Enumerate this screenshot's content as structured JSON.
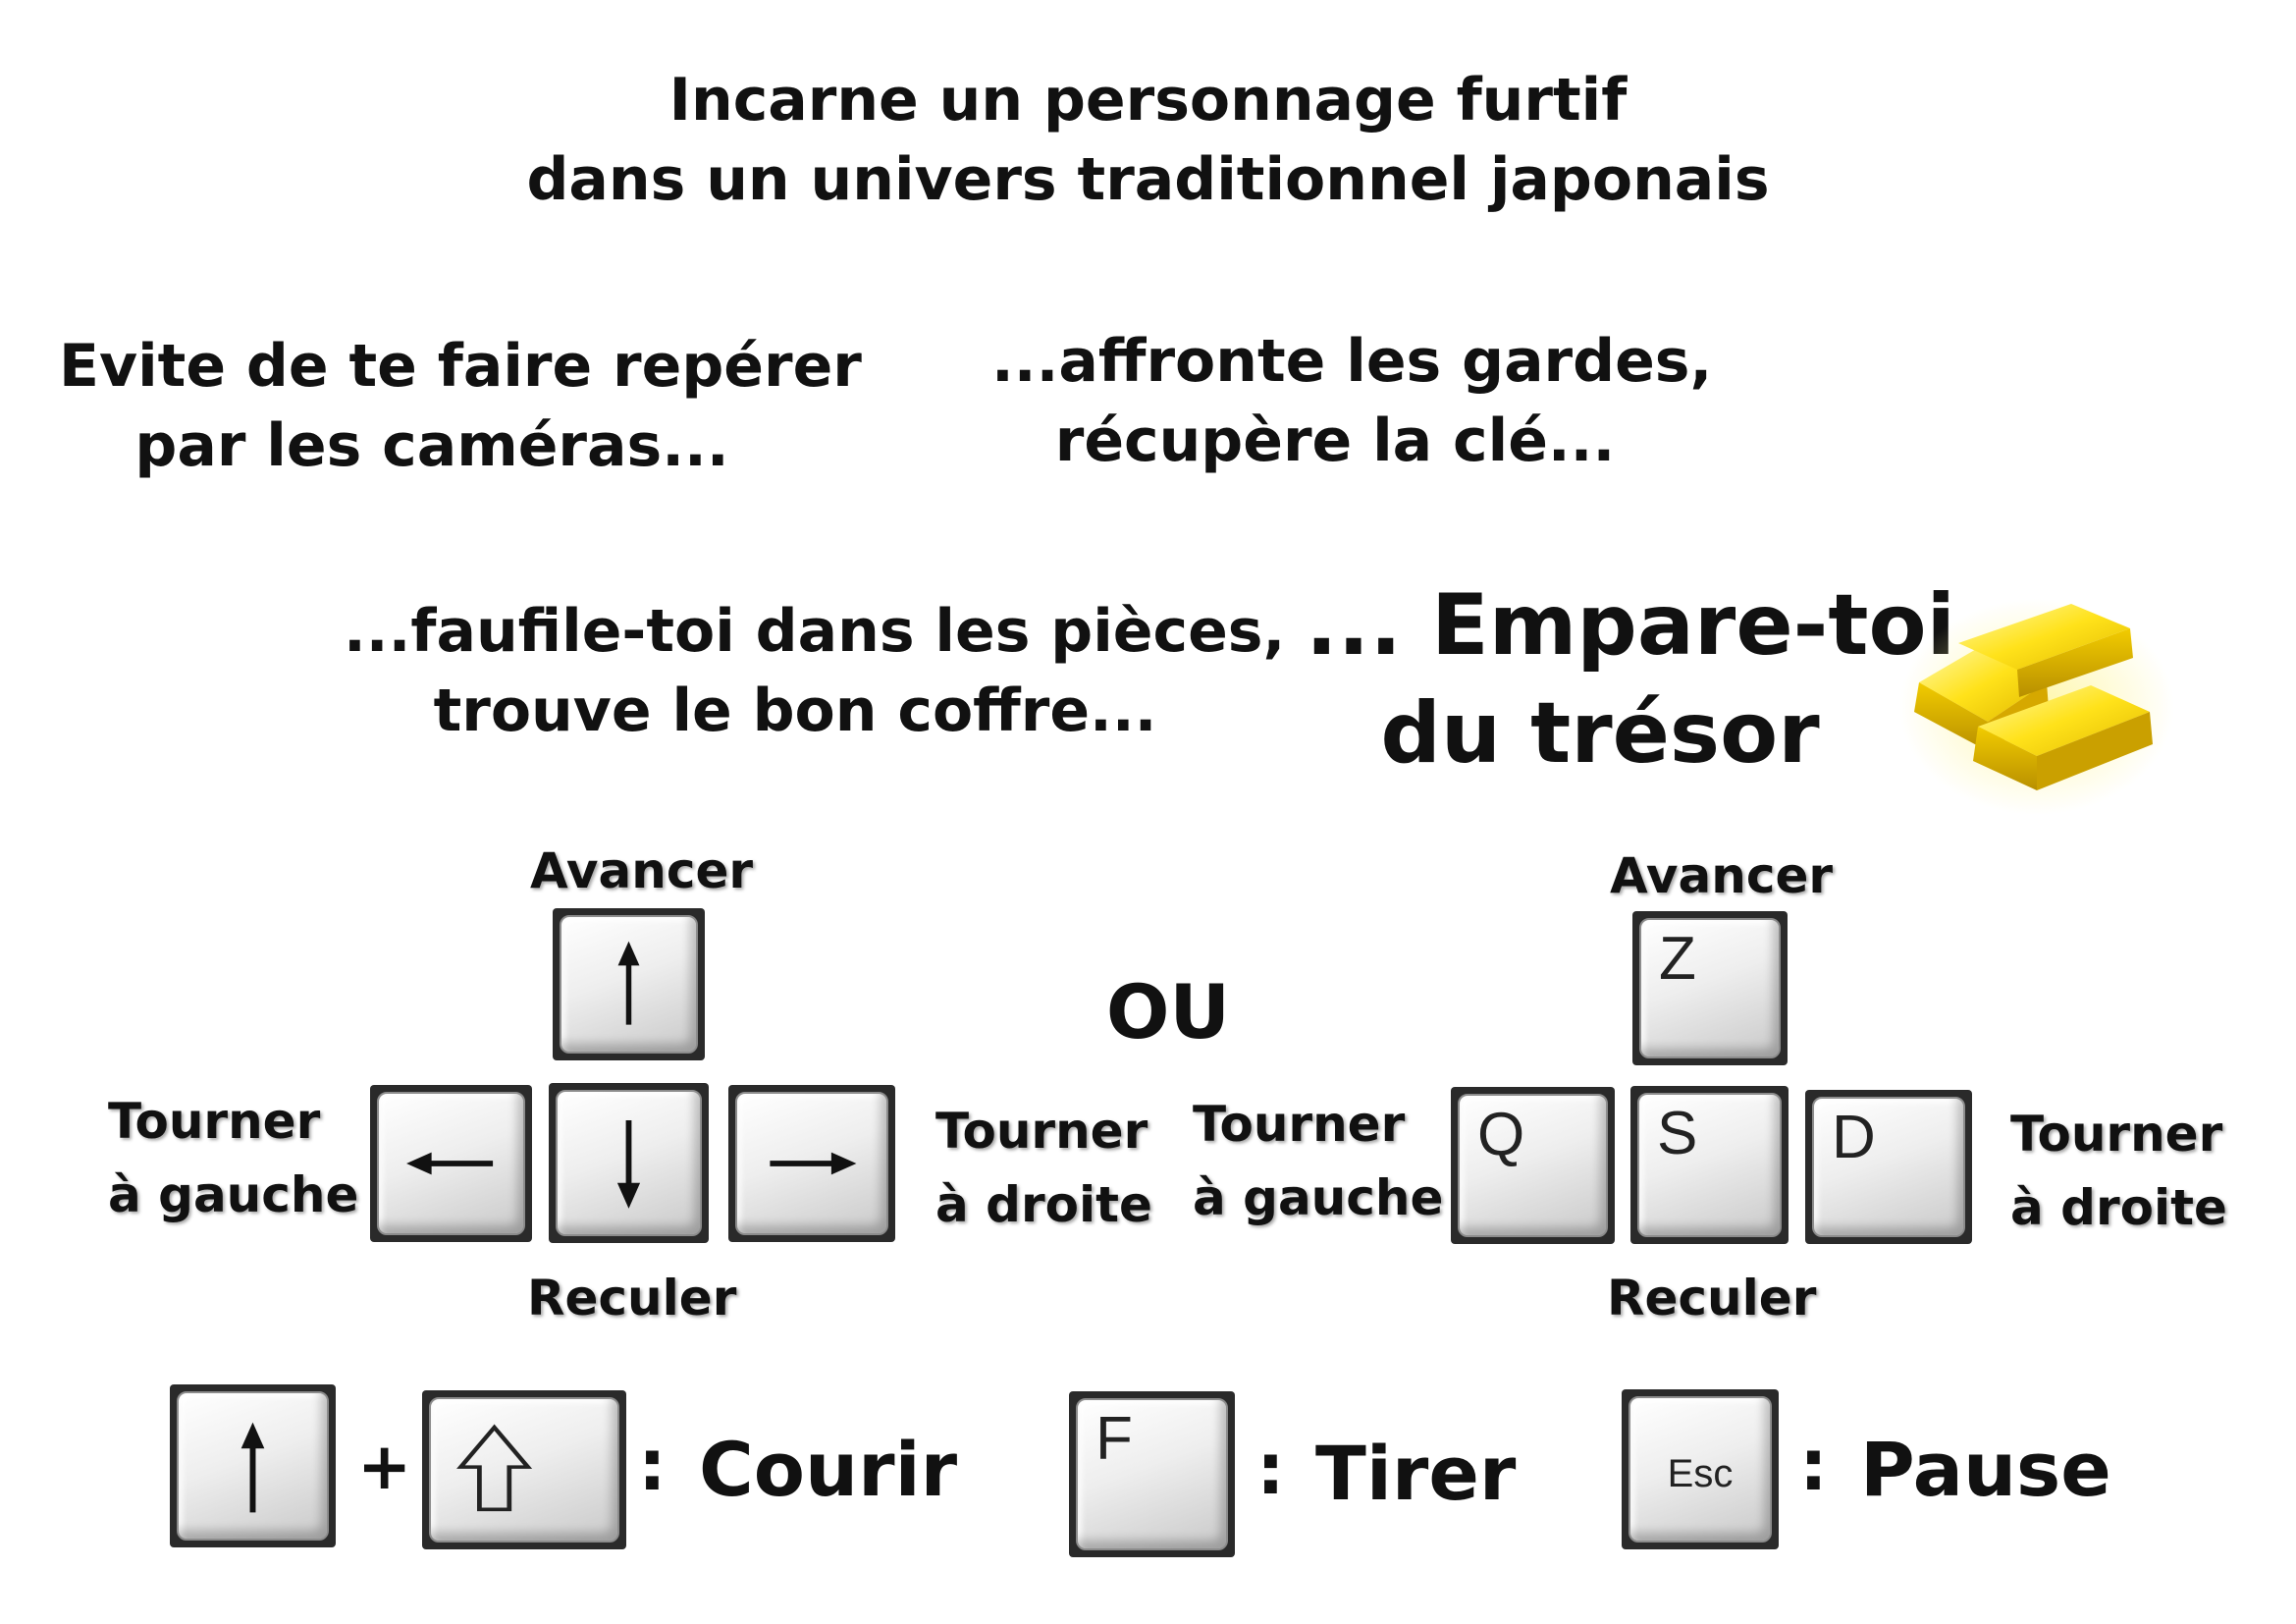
{
  "intro": {
    "line1": "Incarne un personnage furtif",
    "line2": "dans un univers traditionnel japonais"
  },
  "steps": {
    "cameras_line1": "Evite de te faire repérer",
    "cameras_line2": "par les caméras...",
    "guards_line1": "...affronte les gardes,",
    "guards_line2": "récupère la clé...",
    "rooms_line1": "...faufile-toi dans les pièces,",
    "rooms_line2": "trouve le bon coffre...",
    "treasure_line1": "... Empare-toi",
    "treasure_line2": "du trésor"
  },
  "controls_arrows": {
    "forward": "Avancer",
    "back": "Reculer",
    "left_line1": "Tourner",
    "left_line2": "à gauche",
    "right_line1": "Tourner",
    "right_line2": "à droite"
  },
  "or_label": "OU",
  "controls_letters": {
    "forward": "Avancer",
    "back": "Reculer",
    "left_line1": "Tourner",
    "left_line2": "à gauche",
    "right_line1": "Tourner",
    "right_line2": "à droite",
    "key_up": "Z",
    "key_left": "Q",
    "key_down": "S",
    "key_right": "D"
  },
  "actions": {
    "plus": "+",
    "colon": ":",
    "run": "Courir",
    "shoot_key": "F",
    "shoot": "Tirer",
    "pause_key": "Esc",
    "pause": "Pause"
  },
  "icons": [
    "arrow-up-icon",
    "arrow-down-icon",
    "arrow-left-icon",
    "arrow-right-icon",
    "shift-icon",
    "gold-bars-icon"
  ],
  "colors": {
    "text": "#111111",
    "gold": "#f5d400",
    "key_border": "#2a2a2a"
  }
}
